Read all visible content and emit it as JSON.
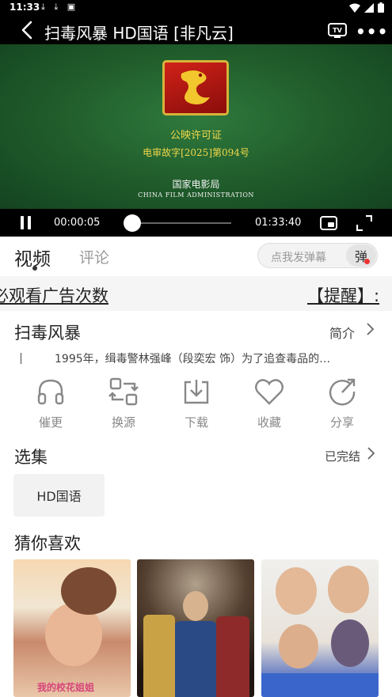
{
  "status_bar": {
    "time": "11:33",
    "notifications": "⤓ ⤓ ▣"
  },
  "title_bar": {
    "title": "扫毒风暴  HD国语 [非凡云]"
  },
  "player": {
    "license_title": "公映许可证",
    "license_code": "电审故字[2025]第094号",
    "agency_cn": "国家电影局",
    "agency_en": "CHINA FILM ADMINISTRATION",
    "current_time": "00:00:05",
    "total_time": "01:33:40",
    "progress": 0.001
  },
  "tabs": {
    "video": "视频",
    "comments": "评论",
    "danmaku_placeholder": "点我发弹幕",
    "danmaku_button": "弹"
  },
  "marquee": {
    "left_text": "必观看广告次数",
    "right_text": "【提醒】:"
  },
  "show": {
    "title": "扫毒风暴",
    "intro_link": "简介",
    "synopsis": "1995年，缉毒警林强峰（段奕宏 饰）为了追查毒品的…"
  },
  "actions": [
    {
      "label": "催更",
      "icon": "headphones-icon"
    },
    {
      "label": "换源",
      "icon": "switch-source-icon"
    },
    {
      "label": "下载",
      "icon": "download-icon"
    },
    {
      "label": "收藏",
      "icon": "heart-icon"
    },
    {
      "label": "分享",
      "icon": "share-icon"
    }
  ],
  "episodes": {
    "title": "选集",
    "status": "已完结",
    "items": [
      "HD国语"
    ]
  },
  "recommendations": {
    "title": "猜你喜欢",
    "items": [
      {
        "caption": "我的校花姐姐"
      },
      {
        "caption": ""
      },
      {
        "caption": ""
      }
    ]
  }
}
